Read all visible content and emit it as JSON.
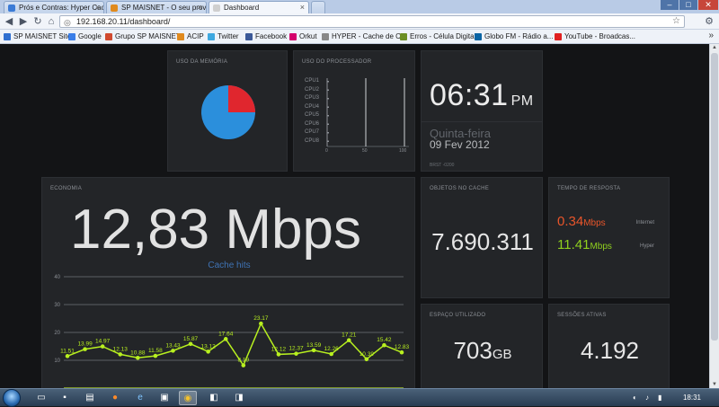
{
  "browser": {
    "tabs": [
      {
        "label": "Prós e Contras: Hyper Cach",
        "color": "#3b7bd6",
        "active": false
      },
      {
        "label": "SP MAISNET - O seu prove",
        "color": "#e08a1e",
        "active": false
      },
      {
        "label": "Dashboard",
        "color": "#cfcfcf",
        "active": true
      }
    ],
    "url": "192.168.20.11/dashboard/",
    "bookmarks": [
      {
        "label": "SP MAISNET Site",
        "color": "#2f6fd0"
      },
      {
        "label": "Google",
        "color": "#3a7ee8"
      },
      {
        "label": "Grupo SP MAISNET",
        "color": "#d04a2f"
      },
      {
        "label": "ACIP",
        "color": "#e08a1e"
      },
      {
        "label": "Twitter",
        "color": "#3ea8e0"
      },
      {
        "label": "Facebook",
        "color": "#3b5998"
      },
      {
        "label": "Orkut",
        "color": "#d4006b"
      },
      {
        "label": "HYPER - Cache de C...",
        "color": "#888888"
      },
      {
        "label": "Erros - Célula Digital",
        "color": "#6b8e23"
      },
      {
        "label": "Globo FM - Rádio a...",
        "color": "#0a64a4"
      },
      {
        "label": "YouTube - Broadcas...",
        "color": "#e02020"
      }
    ]
  },
  "widgets": {
    "memory": {
      "title": "USO DA MEMÓRIA",
      "used_fraction": 0.25,
      "used_color": "#e0262e",
      "free_color": "#2b8fdc"
    },
    "cpu": {
      "title": "USO DO PROCESSADOR",
      "cores": [
        "CPU1",
        "CPU2",
        "CPU3",
        "CPU4",
        "CPU5",
        "CPU6",
        "CPU7",
        "CPU8"
      ],
      "values": [
        0,
        0,
        0,
        0,
        0,
        0,
        0,
        0
      ],
      "axis": [
        "0",
        "50",
        "100"
      ]
    },
    "clock": {
      "time": "06:31",
      "ampm": "PM",
      "day": "Quinta-feira",
      "date": "09 Fev 2012",
      "timezone": "BRST -0200"
    },
    "economy": {
      "title": "ECONOMIA",
      "value": "12,83 Mbps",
      "subtitle": "Cache hits"
    },
    "cache_objects": {
      "title": "OBJETOS NO CACHE",
      "value": "7.690.311"
    },
    "response": {
      "title": "TEMPO DE RESPOSTA",
      "internet": {
        "value": "0.34",
        "unit": "Mbps",
        "label": "Internet",
        "color": "#e8552a"
      },
      "hyper": {
        "value": "11.41",
        "unit": "Mbps",
        "label": "Hyper",
        "color": "#8fcf1e"
      }
    },
    "space": {
      "title": "ESPAÇO UTILIZADO",
      "value": "703",
      "unit": "GB"
    },
    "sessions": {
      "title": "SESSÕES ATIVAS",
      "value": "4.192"
    }
  },
  "chart_data": {
    "type": "line",
    "title": "Cache hits",
    "yticks": [
      "40",
      "30",
      "20",
      "10"
    ],
    "ylim": [
      0,
      40
    ],
    "grid": true,
    "series": [
      {
        "color": "#b8f01f",
        "values": [
          11.51,
          13.99,
          14.97,
          12.13,
          10.88,
          11.58,
          13.43,
          15.87,
          13.12,
          17.64,
          8.19,
          23.17,
          12.12,
          12.37,
          13.59,
          12.26,
          17.21,
          10.39,
          15.42,
          12.83
        ],
        "labels": [
          "11.51",
          "13.99",
          "14.97",
          "12.13",
          "10.88",
          "11.58",
          "13.43",
          "15.87",
          "13.12",
          "17.64",
          "8.19",
          "23.17",
          "12.12",
          "12.37",
          "13.59",
          "12.26",
          "17.21",
          "10.39",
          "15.42",
          "12.83"
        ]
      }
    ]
  },
  "taskbar": {
    "clock": "18:31"
  }
}
